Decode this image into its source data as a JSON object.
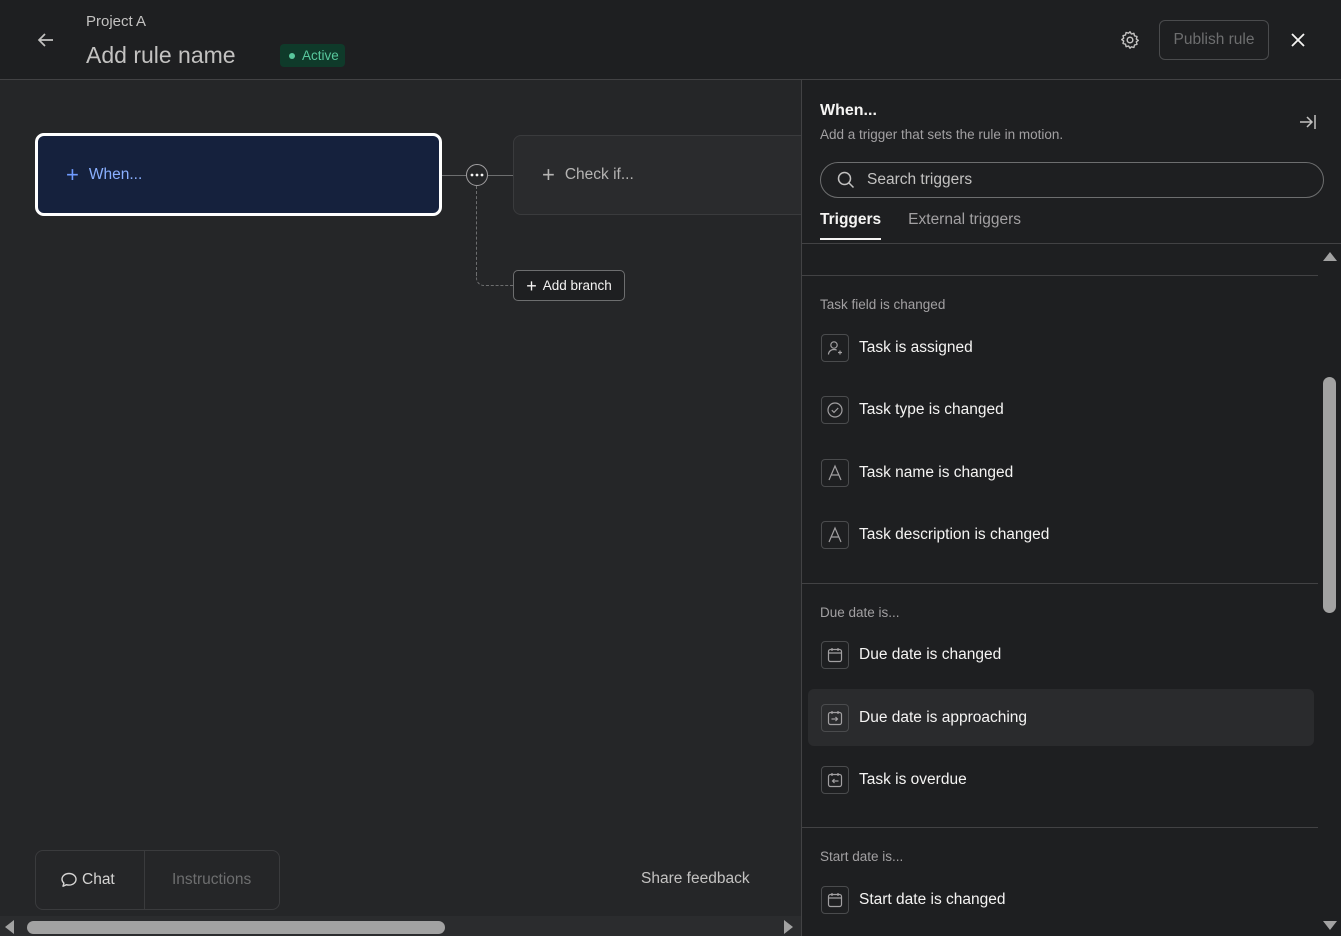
{
  "header": {
    "project": "Project A",
    "rule_name": "Add rule name",
    "status": "Active",
    "publish_label": "Publish rule"
  },
  "canvas": {
    "when_label": "When...",
    "check_label": "Check if...",
    "add_branch_label": "Add branch",
    "chat_label": "Chat",
    "instructions_label": "Instructions",
    "share_feedback_label": "Share feedback"
  },
  "panel": {
    "title": "When...",
    "subtitle": "Add a trigger that sets the rule in motion.",
    "search_placeholder": "Search triggers",
    "tabs": [
      {
        "label": "Triggers",
        "active": true
      },
      {
        "label": "External triggers",
        "active": false
      }
    ],
    "sections": [
      {
        "label": "Task field is changed",
        "items": [
          {
            "label": "Task is assigned",
            "icon": "user-plus-icon"
          },
          {
            "label": "Task type is changed",
            "icon": "check-circle-icon"
          },
          {
            "label": "Task name is changed",
            "icon": "text-a-icon"
          },
          {
            "label": "Task description is changed",
            "icon": "text-a-icon"
          }
        ]
      },
      {
        "label": "Due date is...",
        "items": [
          {
            "label": "Due date is changed",
            "icon": "calendar-icon"
          },
          {
            "label": "Due date is approaching",
            "icon": "calendar-arrow-right-icon"
          },
          {
            "label": "Task is overdue",
            "icon": "calendar-arrow-left-icon"
          }
        ]
      },
      {
        "label": "Start date is...",
        "items": [
          {
            "label": "Start date is changed",
            "icon": "calendar-icon"
          }
        ]
      }
    ]
  },
  "colors": {
    "accent_blue": "#6f9bff",
    "active_green": "#58c79c",
    "panel_bg": "#1e1f21",
    "canvas_bg": "#252628"
  }
}
